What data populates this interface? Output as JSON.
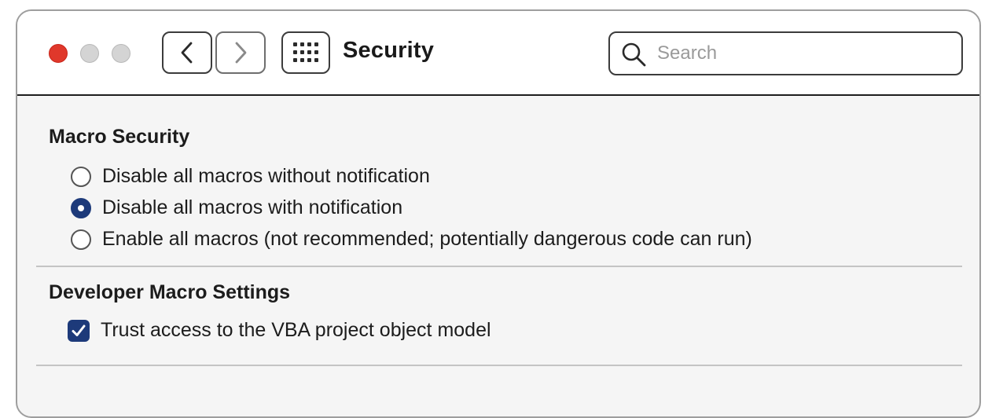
{
  "window": {
    "title": "Security"
  },
  "search": {
    "placeholder": "Search",
    "value": ""
  },
  "macro_security": {
    "title": "Macro Security",
    "options": [
      {
        "label": "Disable all macros without notification",
        "selected": false
      },
      {
        "label": "Disable all macros with notification",
        "selected": true
      },
      {
        "label": "Enable all macros (not recommended; potentially dangerous code can run)",
        "selected": false
      }
    ]
  },
  "developer": {
    "title": "Developer Macro Settings",
    "trust_vba_label": "Trust access to the VBA project object model",
    "trust_vba_checked": true
  },
  "icons": {
    "back": "chevron-left-icon",
    "forward": "chevron-right-icon",
    "grid": "grid-icon",
    "search": "search-icon"
  },
  "colors": {
    "accent": "#1d3a7a",
    "close": "#e0382b",
    "inactive_traffic": "#d4d4d4"
  }
}
